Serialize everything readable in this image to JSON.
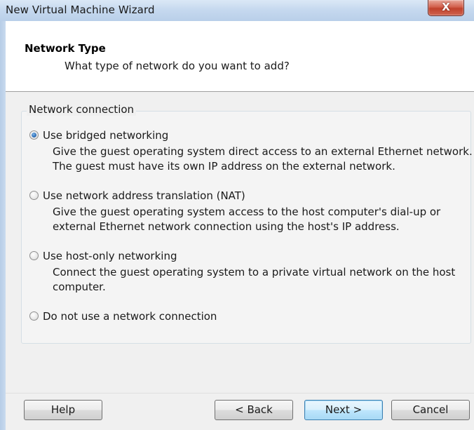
{
  "window": {
    "title": "New Virtual Machine Wizard",
    "close_glyph": "X"
  },
  "header": {
    "title": "Network Type",
    "subtitle": "What type of network do you want to add?"
  },
  "group": {
    "label": "Network connection",
    "options": [
      {
        "label": "Use bridged networking",
        "checked": true,
        "desc": "Give the guest operating system direct access to an external Ethernet network. The guest must have its own IP address on the external network."
      },
      {
        "label": "Use network address translation (NAT)",
        "checked": false,
        "desc": "Give the guest operating system access to the host computer's dial-up or external Ethernet network connection using the host's IP address."
      },
      {
        "label": "Use host-only networking",
        "checked": false,
        "desc": "Connect the guest operating system to a private virtual network on the host computer."
      },
      {
        "label": "Do not use a network connection",
        "checked": false,
        "desc": ""
      }
    ]
  },
  "buttons": {
    "help": "Help",
    "back": "< Back",
    "next": "Next >",
    "cancel": "Cancel"
  },
  "colors": {
    "title_bar": "#c6d9ef",
    "close_button": "#c0412c",
    "default_button_border": "#3c7fb1",
    "radio_checked": "#2e6fb8"
  }
}
